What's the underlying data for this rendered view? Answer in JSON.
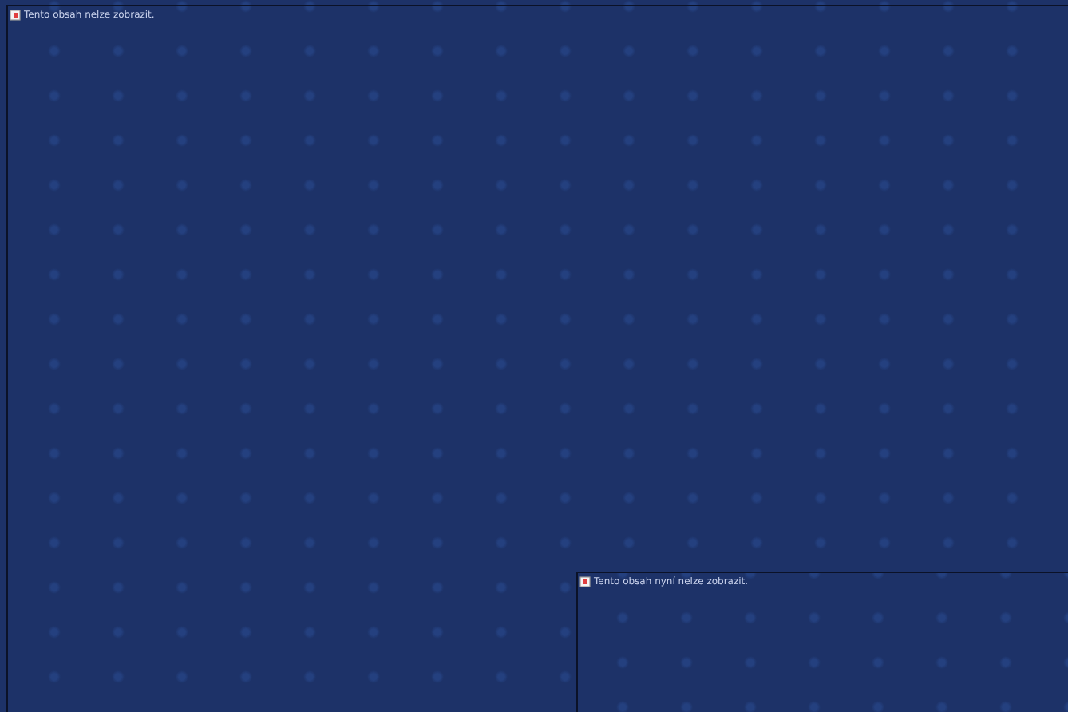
{
  "frames": [
    {
      "message": "Tento obsah nelze zobrazit."
    },
    {
      "message": "Tento obsah nyní nelze zobrazit."
    }
  ]
}
